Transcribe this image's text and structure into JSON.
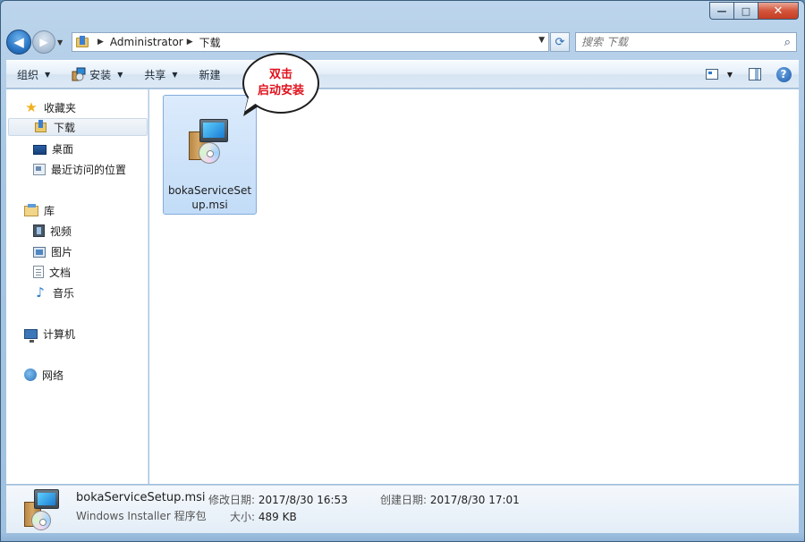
{
  "window": {
    "caption_buttons": {
      "minimize": "—",
      "maximize": "□",
      "close": "✕"
    }
  },
  "address": {
    "crumbs": [
      "Administrator",
      "下载"
    ],
    "search_placeholder": "搜索 下载"
  },
  "toolbar": {
    "organize": "组织",
    "install": "安装",
    "share": "共享",
    "new_folder_partial": "新建"
  },
  "nav": {
    "favorites": {
      "label": "收藏夹",
      "items": [
        "下载",
        "桌面",
        "最近访问的位置"
      ]
    },
    "libraries": {
      "label": "库",
      "items": [
        "视频",
        "图片",
        "文档",
        "音乐"
      ]
    },
    "computer": "计算机",
    "network": "网络"
  },
  "files": [
    {
      "name": "bokaServiceSetup.msi",
      "selected": true
    }
  ],
  "callout": {
    "line1": "双击",
    "line2": "启动安装",
    "color": "#e0101b"
  },
  "details": {
    "name": "bokaServiceSetup.msi",
    "type": "Windows Installer 程序包",
    "modified_label": "修改日期:",
    "modified_value": "2017/8/30 16:53",
    "created_label": "创建日期:",
    "created_value": "2017/8/30 17:01",
    "size_label": "大小:",
    "size_value": "489 KB"
  }
}
